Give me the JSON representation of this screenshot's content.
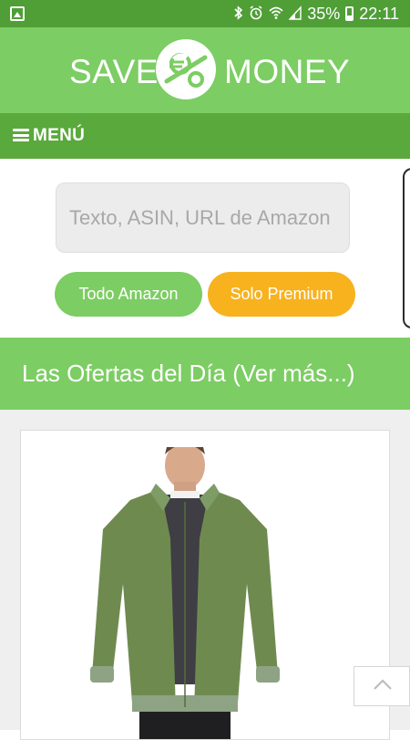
{
  "status_bar": {
    "battery_percent": "35%",
    "time": "22:11",
    "icons": [
      "image-notification-icon",
      "bluetooth-icon",
      "alarm-icon",
      "wifi-icon",
      "signal-icon",
      "battery-icon"
    ]
  },
  "header": {
    "logo_left": "SAVE",
    "logo_right": "MONEY",
    "logo_icon": "euro-percent-icon"
  },
  "menu": {
    "label": "MENÚ",
    "icon": "hamburger-icon"
  },
  "search": {
    "placeholder": "Texto, ASIN, URL de Amazon",
    "value": ""
  },
  "buttons": {
    "all_amazon": "Todo Amazon",
    "premium_only": "Solo Premium"
  },
  "offers": {
    "title": "Las Ofertas del Día (Ver más...)"
  },
  "product": {
    "image": "green-jacket-product-image"
  },
  "colors": {
    "brand_green": "#7ccd63",
    "menu_green": "#5aa93c",
    "status_green": "#4f9e36",
    "premium_orange": "#f7b21e"
  }
}
